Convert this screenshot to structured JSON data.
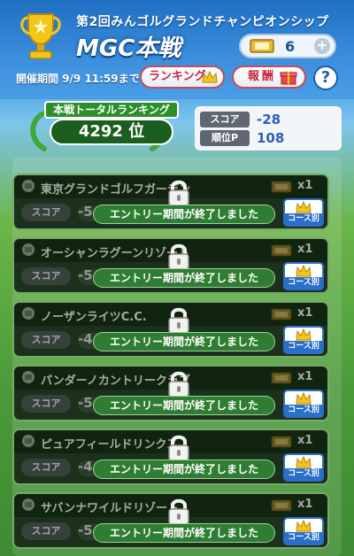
{
  "header": {
    "subtitle": "第2回みんゴルグランドチャンピオンシップ",
    "title": "MGC本戦",
    "ticket_count": "6",
    "plus": "+",
    "period": "開催期間 9/9 11:59まで",
    "ranking_button": "ランキング",
    "reward_button": "報酬",
    "help": "?"
  },
  "ranking": {
    "label": "本戦トータルランキング",
    "value": "4292 位",
    "score_label": "スコア",
    "score_value": "-28",
    "points_label": "順位P",
    "points_value": "108"
  },
  "course_common": {
    "score_label": "スコア",
    "ended_text": "エントリー期間が終了しました",
    "course_btn_label": "コース別"
  },
  "courses": [
    {
      "name": "東京グランドゴルフガーデン",
      "multiplier": "x1",
      "score": "-5"
    },
    {
      "name": "オーシャンラグーンリゾート",
      "multiplier": "x1",
      "score": "-5"
    },
    {
      "name": "ノーザンライツC.C.",
      "multiplier": "x1",
      "score": "-4"
    },
    {
      "name": "パンダーノカントリークラブ",
      "multiplier": "x1",
      "score": "-5"
    },
    {
      "name": "ピュアフィールドリンクス",
      "multiplier": "x1",
      "score": "-4"
    },
    {
      "name": "サバンナワイルドリゾート",
      "multiplier": "x1",
      "score": "-5"
    }
  ],
  "colors": {
    "accent_red": "#c7283e",
    "accent_blue": "#2a6fc9",
    "panel_green": "#2c8f2a"
  }
}
